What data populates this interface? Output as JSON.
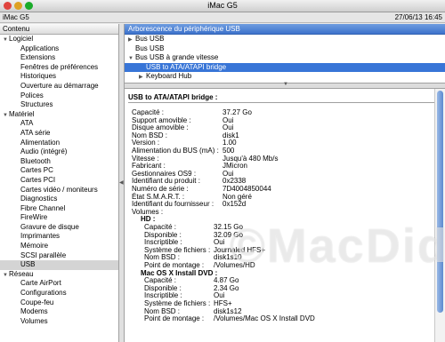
{
  "window": {
    "title": "iMac G5"
  },
  "infobar": {
    "machine": "iMac G5",
    "date": "27/06/13 16:45"
  },
  "sidebar": {
    "header": "Contenu",
    "rows": [
      {
        "type": "cat",
        "label": "Logiciel"
      },
      {
        "type": "item",
        "label": "Applications"
      },
      {
        "type": "item",
        "label": "Extensions"
      },
      {
        "type": "item",
        "label": "Fenêtres de préférences"
      },
      {
        "type": "item",
        "label": "Historiques"
      },
      {
        "type": "item",
        "label": "Ouverture au démarrage"
      },
      {
        "type": "item",
        "label": "Polices"
      },
      {
        "type": "item",
        "label": "Structures"
      },
      {
        "type": "cat",
        "label": "Matériel"
      },
      {
        "type": "item",
        "label": "ATA"
      },
      {
        "type": "item",
        "label": "ATA série"
      },
      {
        "type": "item",
        "label": "Alimentation"
      },
      {
        "type": "item",
        "label": "Audio (intégré)"
      },
      {
        "type": "item",
        "label": "Bluetooth"
      },
      {
        "type": "item",
        "label": "Cartes PC"
      },
      {
        "type": "item",
        "label": "Cartes PCI"
      },
      {
        "type": "item",
        "label": "Cartes vidéo / moniteurs"
      },
      {
        "type": "item",
        "label": "Diagnostics"
      },
      {
        "type": "item",
        "label": "Fibre Channel"
      },
      {
        "type": "item",
        "label": "FireWire"
      },
      {
        "type": "item",
        "label": "Gravure de disque"
      },
      {
        "type": "item",
        "label": "Imprimantes"
      },
      {
        "type": "item",
        "label": "Mémoire"
      },
      {
        "type": "item",
        "label": "SCSI parallèle"
      },
      {
        "type": "item",
        "label": "USB",
        "selected": true
      },
      {
        "type": "cat",
        "label": "Réseau"
      },
      {
        "type": "item",
        "label": "Carte AirPort"
      },
      {
        "type": "item",
        "label": "Configurations"
      },
      {
        "type": "item",
        "label": "Coupe-feu"
      },
      {
        "type": "item",
        "label": "Modems"
      },
      {
        "type": "item",
        "label": "Volumes"
      }
    ]
  },
  "tree": {
    "header": "Arborescence du périphérique USB",
    "rows": [
      {
        "label": "Bus USB",
        "level": 0,
        "arrow": "right"
      },
      {
        "label": "Bus USB",
        "level": 0,
        "arrow": "none"
      },
      {
        "label": "Bus USB à grande vitesse",
        "level": 0,
        "arrow": "down"
      },
      {
        "label": "USB to ATA/ATAPI bridge",
        "level": 1,
        "arrow": "none",
        "selected": true
      },
      {
        "label": "Keyboard Hub",
        "level": 1,
        "arrow": "right"
      }
    ]
  },
  "detail": {
    "title": "USB to ATA/ATAPI bridge :",
    "rows": [
      {
        "k": "Capacité :",
        "v": "37.27 Go"
      },
      {
        "k": "Support amovible :",
        "v": "Oui"
      },
      {
        "k": "Disque amovible :",
        "v": "Oui"
      },
      {
        "k": "Nom BSD :",
        "v": "disk1"
      },
      {
        "k": "Version :",
        "v": "1.00"
      },
      {
        "k": "Alimentation du BUS (mA) :",
        "v": "500"
      },
      {
        "k": "Vitesse :",
        "v": "Jusqu'à 480 Mb/s"
      },
      {
        "k": "Fabricant :",
        "v": "JMicron"
      },
      {
        "k": "Gestionnaires OS9 :",
        "v": "Oui"
      },
      {
        "k": "Identifiant du produit :",
        "v": "0x2338"
      },
      {
        "k": "Numéro de série :",
        "v": "7D4004850044"
      },
      {
        "k": "État S.M.A.R.T. :",
        "v": "Non géré"
      },
      {
        "k": "Identifiant du fournisseur :",
        "v": "0x152d"
      },
      {
        "k": "Volumes :",
        "v": ""
      }
    ],
    "volumes": [
      {
        "name": "HD :",
        "rows": [
          {
            "k": "Capacité :",
            "v": "32.15 Go"
          },
          {
            "k": "Disponible :",
            "v": "32.09 Go"
          },
          {
            "k": "Inscriptible :",
            "v": "Oui"
          },
          {
            "k": "Système de fichiers :",
            "v": "Journaled HFS+"
          },
          {
            "k": "Nom BSD :",
            "v": "disk1s10"
          },
          {
            "k": "Point de montage :",
            "v": "/Volumes/HD"
          }
        ]
      },
      {
        "name": "Mac OS X Install DVD :",
        "rows": [
          {
            "k": "Capacité :",
            "v": "4.87 Go"
          },
          {
            "k": "Disponible :",
            "v": "2.34 Go"
          },
          {
            "k": "Inscriptible :",
            "v": "Oui"
          },
          {
            "k": "Système de fichiers :",
            "v": "HFS+"
          },
          {
            "k": "Nom BSD :",
            "v": "disk1s12"
          },
          {
            "k": "Point de montage :",
            "v": "/Volumes/Mac OS X Install DVD"
          }
        ]
      }
    ]
  },
  "watermark": "©MacDid",
  "colors": {
    "selection": "#3875d7",
    "header": "#4a80d6",
    "close": "#e0443e",
    "minimize": "#dea123",
    "zoom": "#1aab29"
  }
}
